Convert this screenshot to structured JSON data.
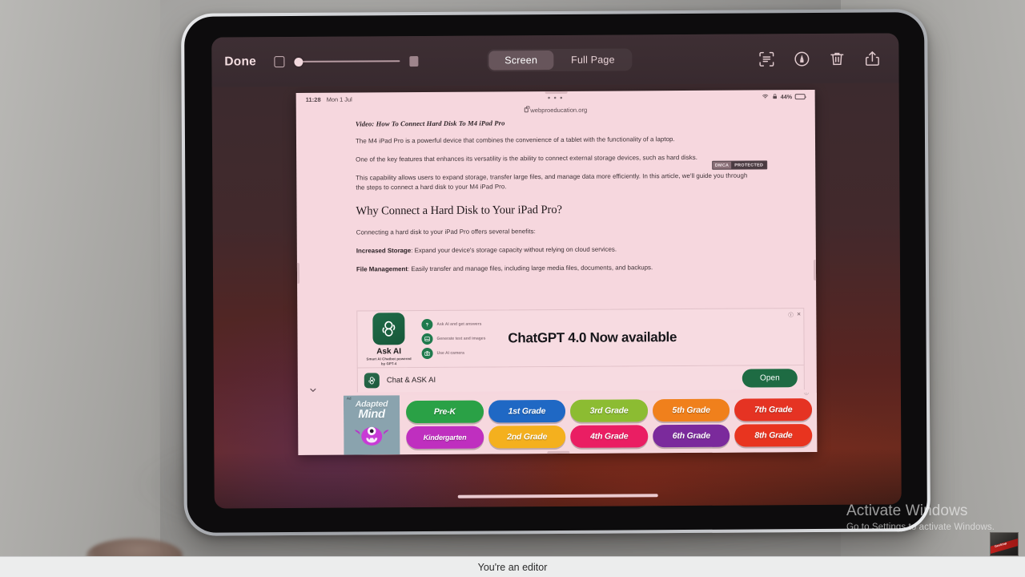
{
  "markup_toolbar": {
    "done_label": "Done",
    "segments": [
      {
        "label": "Screen",
        "selected": true
      },
      {
        "label": "Full Page",
        "selected": false
      }
    ],
    "icons": [
      {
        "name": "text-scan-icon"
      },
      {
        "name": "markup-pen-icon"
      },
      {
        "name": "trash-icon"
      },
      {
        "name": "share-icon"
      }
    ]
  },
  "ipad_status_bar": {
    "time": "11:28",
    "date": "Mon 1 Jul",
    "more_dots": "• • •",
    "battery_percent": "44%",
    "wifi_icon": "wifi-icon",
    "lock_icon": "lock-icon"
  },
  "browser": {
    "url": "webproeducation.org"
  },
  "article": {
    "kicker": "Video: How To Connect Hard Disk To M4 iPad Pro",
    "paragraphs": [
      "The M4 iPad Pro is a powerful device that combines the convenience of a tablet with the functionality of a laptop.",
      "One of the key features that enhances its versatility is the ability to connect external storage devices, such as hard disks.",
      "This capability allows users to expand storage, transfer large files, and manage data more efficiently. In this article, we'll guide you through the steps to connect a hard disk to your M4 iPad Pro."
    ],
    "heading": "Why Connect a Hard Disk to Your iPad Pro?",
    "intro": "Connecting a hard disk to your iPad Pro offers several benefits:",
    "benefits": [
      {
        "term": "Increased Storage",
        "text": ": Expand your device's storage capacity without relying on cloud services."
      },
      {
        "term": "File Management",
        "text": ": Easily transfer and manage files, including large media files, documents, and backups."
      }
    ],
    "dmca_badge": {
      "left": "DMCA",
      "right": "PROTECTED"
    }
  },
  "ad_chatgpt": {
    "app_name": "Ask AI",
    "app_subtitle": "Smart AI Chatbot\npowered by GPT-4",
    "headline": "ChatGPT 4.0 Now available",
    "features": [
      {
        "icon": "question-mark-icon",
        "text": "Ask AI and get answers"
      },
      {
        "icon": "image-icon",
        "text": "Generate text and images"
      },
      {
        "icon": "camera-icon",
        "text": "Use AI camera"
      }
    ],
    "install_label": "Chat & ASK AI",
    "open_button": "Open",
    "info_icon": "info-icon",
    "close_icon": "close-icon"
  },
  "ad_adaptedmind": {
    "logo_line1": "Adapted",
    "logo_line2": "Mind",
    "ad_marker": "Ad",
    "grades": [
      {
        "label": "Pre-K",
        "color": "#2aa146"
      },
      {
        "label": "1st Grade",
        "color": "#1f68c4"
      },
      {
        "label": "3rd Grade",
        "color": "#8cbc32"
      },
      {
        "label": "5th Grade",
        "color": "#f0801c"
      },
      {
        "label": "7th Grade",
        "color": "#e53323"
      },
      {
        "label": "Kindergarten",
        "color": "#bf2fbf"
      },
      {
        "label": "2nd Grade",
        "color": "#f4b01e"
      },
      {
        "label": "4th Grade",
        "color": "#ea1e63"
      },
      {
        "label": "6th Grade",
        "color": "#7b2a9c"
      },
      {
        "label": "8th Grade",
        "color": "#e8341f"
      }
    ],
    "info_icon": "info-icon",
    "close_icon": "close-icon"
  },
  "windows_watermark": {
    "line1": "Activate Windows",
    "line2": "Go to Settings to activate Windows."
  },
  "thumbnail": {
    "label": "Desktop"
  },
  "caption": {
    "text": "You're an editor"
  }
}
